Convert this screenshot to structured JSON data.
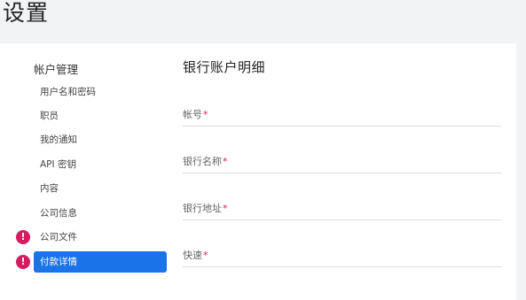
{
  "page": {
    "title": "设置"
  },
  "sidebar": {
    "header": "帐户管理",
    "items": [
      {
        "label": "用户名和密码",
        "alert": false,
        "active": false
      },
      {
        "label": "职员",
        "alert": false,
        "active": false
      },
      {
        "label": "我的通知",
        "alert": false,
        "active": false
      },
      {
        "label": "API 密钥",
        "alert": false,
        "active": false
      },
      {
        "label": "内容",
        "alert": false,
        "active": false
      },
      {
        "label": "公司信息",
        "alert": false,
        "active": false
      },
      {
        "label": "公司文件",
        "alert": true,
        "active": false
      },
      {
        "label": "付款详情",
        "alert": true,
        "active": true
      }
    ],
    "alert_glyph": "!"
  },
  "main": {
    "section_title": "银行账户明细",
    "required_marker": "*",
    "fields": [
      {
        "label": "帐号",
        "value": ""
      },
      {
        "label": "银行名称",
        "value": ""
      },
      {
        "label": "银行地址",
        "value": ""
      },
      {
        "label": "快速",
        "value": ""
      }
    ]
  },
  "colors": {
    "accent": "#1a73e8",
    "alert": "#d81b60",
    "background": "#f2f3f5"
  }
}
